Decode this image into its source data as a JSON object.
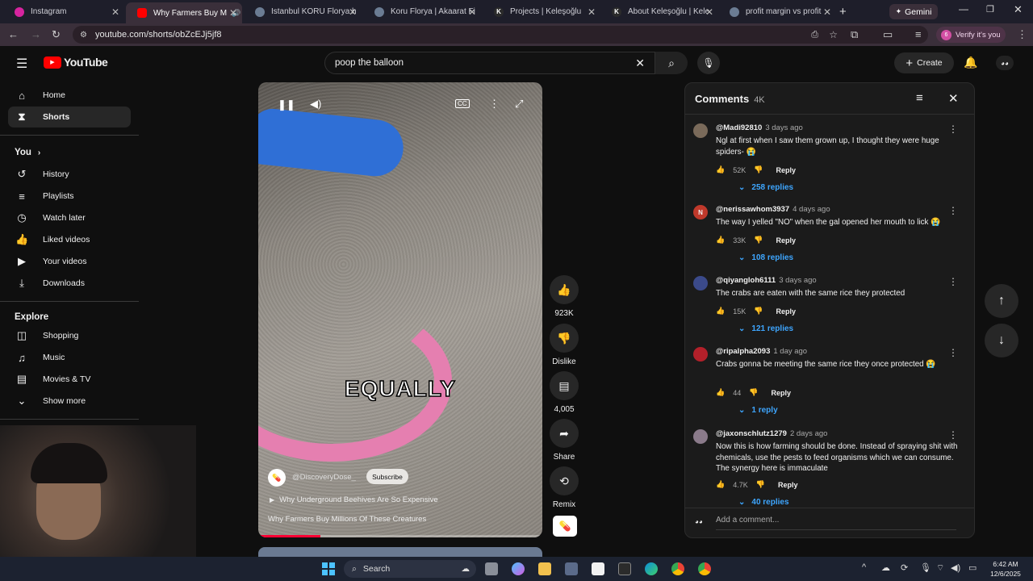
{
  "browser": {
    "tabs": [
      {
        "title": "Instagram",
        "color": "#d6249f"
      },
      {
        "title": "Why Farmers Buy M",
        "color": "#ff0000"
      },
      {
        "title": "Istanbul KORU Florya h",
        "color": "#6b7c93"
      },
      {
        "title": "Koru Florya | Akaarat Fi",
        "color": "#6b7c93"
      },
      {
        "title": "Projects | Keleşoğlu",
        "color": "#2b2b2b"
      },
      {
        "title": "About Keleşoğlu | Kele",
        "color": "#2b2b2b"
      },
      {
        "title": "profit margin vs profit",
        "color": "#6b7c93"
      }
    ],
    "gemini_label": "Gemini",
    "url": "youtube.com/shorts/obZcEJj5jf8",
    "verify_label": "Verify it's you",
    "verify_badge": "6"
  },
  "youtube": {
    "logo_text": "YouTube",
    "search_query": "poop the balloon",
    "create_label": "Create"
  },
  "sidebar": {
    "top": [
      {
        "label": "Home",
        "icon": "home-icon"
      },
      {
        "label": "Shorts",
        "icon": "shorts-icon"
      }
    ],
    "you_title": "You",
    "you_items": [
      {
        "label": "History",
        "icon": "history-icon"
      },
      {
        "label": "Playlists",
        "icon": "playlists-icon"
      },
      {
        "label": "Watch later",
        "icon": "clock-icon"
      },
      {
        "label": "Liked videos",
        "icon": "like-icon"
      },
      {
        "label": "Your videos",
        "icon": "video-icon"
      },
      {
        "label": "Downloads",
        "icon": "download-icon"
      }
    ],
    "explore_title": "Explore",
    "explore_items": [
      {
        "label": "Shopping",
        "icon": "bag-icon"
      },
      {
        "label": "Music",
        "icon": "music-icon"
      },
      {
        "label": "Movies & TV",
        "icon": "film-icon"
      },
      {
        "label": "Show more",
        "icon": "chevron-down-icon"
      }
    ]
  },
  "video": {
    "caption": "EQUALLY",
    "channel": "@DiscoveryDose_",
    "subscribe_label": "Subscribe",
    "related_title": "Why Underground Beehives Are So Expensive",
    "title": "Why Farmers Buy Millions Of These Creatures",
    "progress_fraction": 0.22
  },
  "actions": {
    "likes": "923K",
    "dislike_label": "Dislike",
    "comments_count": "4,005",
    "share_label": "Share",
    "remix_label": "Remix"
  },
  "comments": {
    "title": "Comments",
    "count": "4K",
    "add_placeholder": "Add a comment...",
    "reply_label": "Reply",
    "items": [
      {
        "handle": "@Madi92810",
        "time": "3 days ago",
        "text": "Ngl at first when I saw them grown up, I thought they were huge spiders- 😭",
        "likes": "52K",
        "replies": "258 replies",
        "avatar_color": "#7a6a5a"
      },
      {
        "handle": "@nerissawhom3937",
        "time": "4 days ago",
        "text": "The way I yelled \"NO\" when the gal opened her mouth to lick 😭",
        "likes": "33K",
        "replies": "108 replies",
        "avatar_color": "#c0392b",
        "avatar_letter": "N"
      },
      {
        "handle": "@qiyangloh6111",
        "time": "3 days ago",
        "text": "The crabs are eaten with the same rice they protected",
        "likes": "15K",
        "replies": "121 replies",
        "avatar_color": "#3b4a8a"
      },
      {
        "handle": "@ripalpha2093",
        "time": "1 day ago",
        "text": "Crabs gonna be meeting the same rice they once protected 😭",
        "likes": "44",
        "replies": "1 reply",
        "avatar_color": "#b3202a"
      },
      {
        "handle": "@jaxonschlutz1279",
        "time": "2 days ago",
        "text": "Now this is how farming should be done. Instead of spraying shit with chemicals, use the pests to feed organisms which we can consume. The synergy here is immaculate",
        "likes": "4.7K",
        "replies": "40 replies",
        "avatar_color": "#8a7a8a"
      }
    ]
  },
  "taskbar": {
    "search_label": "Search",
    "time": "6:42 AM",
    "date": "12/6/2025"
  }
}
